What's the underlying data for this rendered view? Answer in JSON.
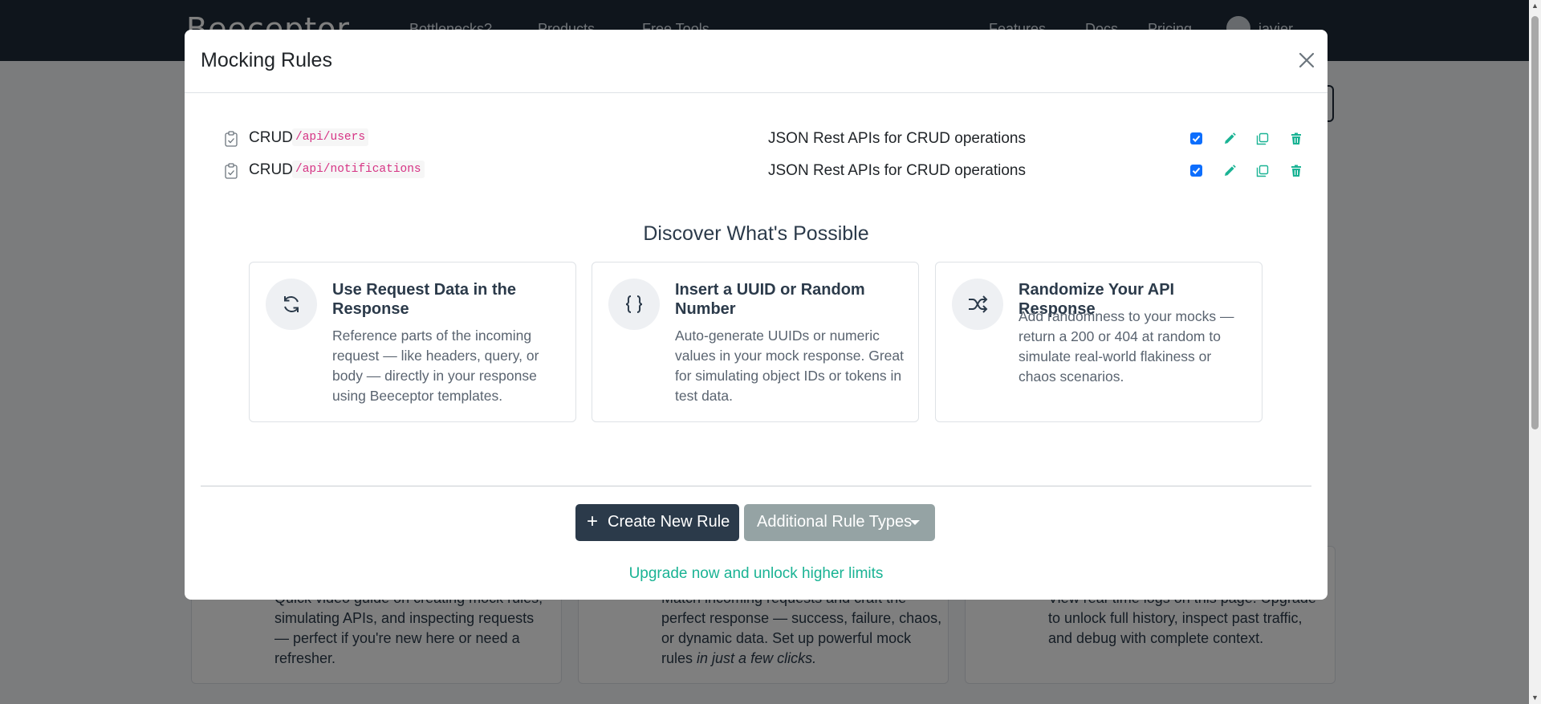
{
  "background": {
    "logo": "Beeceptor",
    "nav": [
      "Bottlenecks?",
      "Products",
      "Free Tools",
      "Features",
      "Docs",
      "Pricing",
      "javier"
    ],
    "cards": [
      {
        "text": "Quick video guide on creating mock rules, simulating APIs, and inspecting requests — perfect if you're new here or need a refresher."
      },
      {
        "text": "Match incoming requests and craft the perfect response — success, failure, chaos, or dynamic data. Set up powerful mock rules",
        "emphasis": "in just a few clicks."
      },
      {
        "text": "View real-time logs on this page. Upgrade to unlock full history, inspect past traffic, and debug with complete context."
      }
    ]
  },
  "modal": {
    "title": "Mocking Rules",
    "rules": [
      {
        "type": "CRUD",
        "path": "/api/users",
        "description": "JSON Rest APIs for CRUD operations",
        "enabled": true
      },
      {
        "type": "CRUD",
        "path": "/api/notifications",
        "description": "JSON Rest APIs for CRUD operations",
        "enabled": true
      }
    ],
    "discover_title": "Discover What's Possible",
    "features": [
      {
        "icon": "refresh-icon",
        "title": "Use Request Data in the Response",
        "text": "Reference parts of the incoming request — like headers, query, or body — directly in your response using Beeceptor templates."
      },
      {
        "icon": "braces-icon",
        "title": "Insert a UUID or Random Number",
        "text": "Auto-generate UUIDs or numeric values in your mock response. Great for simulating object IDs or tokens in test data."
      },
      {
        "icon": "shuffle-icon",
        "title": "Randomize Your API Response",
        "text": "Add randomness to your mocks — return a 200 or 404 at random to simulate real-world flakiness or chaos scenarios."
      }
    ],
    "create_button": "Create New Rule",
    "additional_button": "Additional Rule Types",
    "upgrade_link": "Upgrade now and unlock higher limits"
  },
  "colors": {
    "navy": "#2b3a4a",
    "accent_green": "#1ab394",
    "path_pink": "#d63384",
    "checkbox_blue": "#0d6efd",
    "muted_button": "#95a3a4"
  }
}
